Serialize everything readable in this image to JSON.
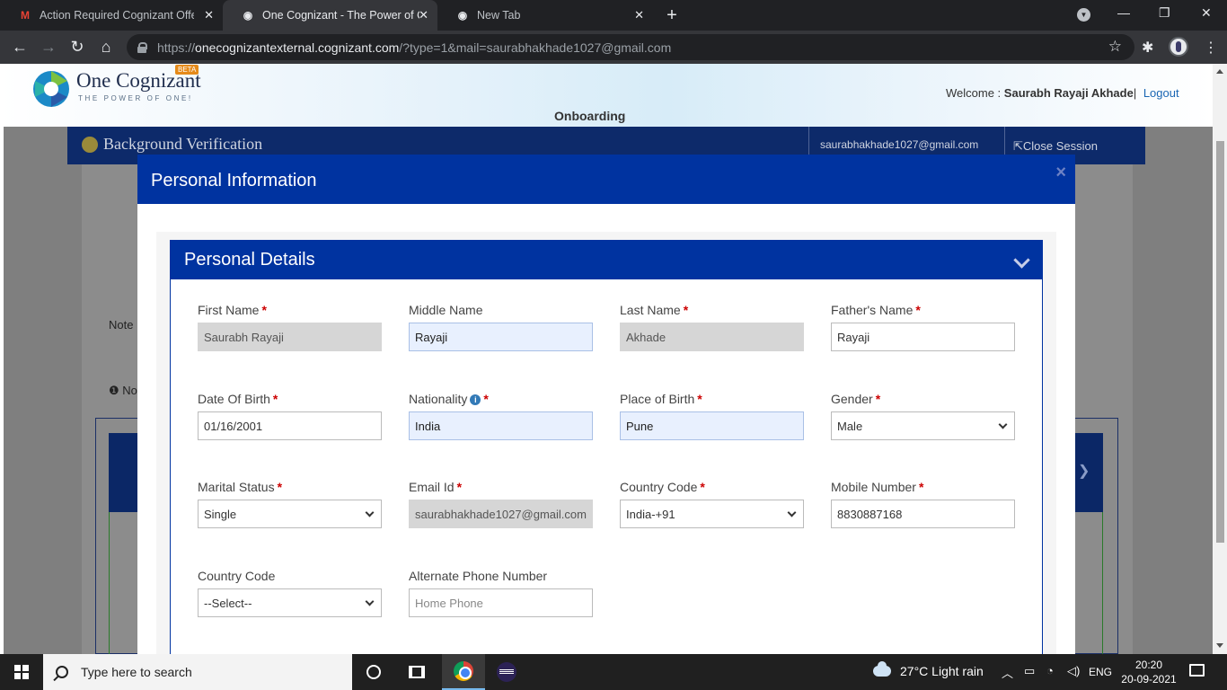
{
  "browser": {
    "tabs": [
      {
        "title": "Action Required Cognizant Offer",
        "favicon": "gmail-icon",
        "active": false
      },
      {
        "title": "One Cognizant - The Power of On",
        "favicon": "chrome-icon",
        "active": true
      },
      {
        "title": "New Tab",
        "favicon": "chrome-icon",
        "active": false
      }
    ],
    "url_scheme": "https://",
    "url_host": "onecognizantexternal.cognizant.com",
    "url_path": "/?type=1&mail=saurabhakhade1027@gmail.com"
  },
  "header": {
    "logo_text": "One Cognizant",
    "logo_tagline": "THE POWER OF ONE!",
    "beta": "BETA",
    "welcome_label": "Welcome :",
    "user_name": "Saurabh Rayaji Akhade",
    "separator": "|",
    "logout": "Logout",
    "section": "Onboarding"
  },
  "background": {
    "title": "Background Verification",
    "email": "saurabhakhade1027@gmail.com",
    "close_session": "Close Session",
    "note1": "Note",
    "note2": "No"
  },
  "modal": {
    "title": "Personal Information",
    "close": "×",
    "panel_title": "Personal Details"
  },
  "form": {
    "first_name": {
      "label": "First Name",
      "value": "Saurabh Rayaji"
    },
    "middle_name": {
      "label": "Middle Name",
      "value": "Rayaji"
    },
    "last_name": {
      "label": "Last Name",
      "value": "Akhade"
    },
    "father_name": {
      "label": "Father's Name",
      "value": "Rayaji"
    },
    "dob": {
      "label": "Date Of Birth",
      "value": "01/16/2001"
    },
    "nationality": {
      "label": "Nationality",
      "value": "India"
    },
    "place_of_birth": {
      "label": "Place of Birth",
      "value": "Pune"
    },
    "gender": {
      "label": "Gender",
      "value": "Male"
    },
    "marital_status": {
      "label": "Marital Status",
      "value": "Single"
    },
    "email": {
      "label": "Email Id",
      "value": "saurabhakhade1027@gmail.com"
    },
    "country_code": {
      "label": "Country Code",
      "value": "India-+91"
    },
    "mobile": {
      "label": "Mobile Number",
      "value": "8830887168"
    },
    "alt_country_code": {
      "label": "Country Code",
      "value": "--Select--"
    },
    "alt_phone": {
      "label": "Alternate Phone Number",
      "placeholder": "Home Phone"
    },
    "required_mark": "*"
  },
  "taskbar": {
    "search_placeholder": "Type here to search",
    "weather": "27°C  Light rain",
    "language": "ENG",
    "time": "20:20",
    "date": "20-09-2021"
  },
  "colors": {
    "primary_blue": "#0033a0",
    "required_red": "#cc0000"
  }
}
